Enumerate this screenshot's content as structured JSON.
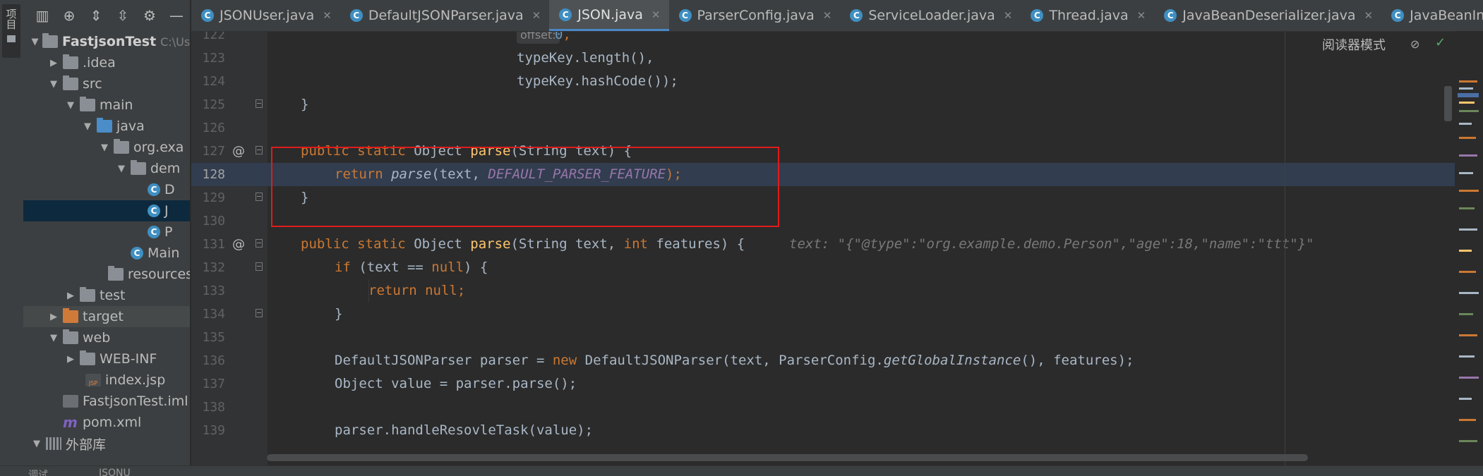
{
  "left_strip": {
    "label": "项目"
  },
  "project": {
    "root": {
      "name": "FastjsonTest",
      "path": "C:\\Use"
    },
    "items": [
      {
        "label": ".idea"
      },
      {
        "label": "src"
      },
      {
        "label": "main"
      },
      {
        "label": "java"
      },
      {
        "label": "org.exa"
      },
      {
        "label": "dem"
      },
      {
        "label": "D"
      },
      {
        "label": "J"
      },
      {
        "label": "P"
      },
      {
        "label": "Main"
      },
      {
        "label": "resources"
      },
      {
        "label": "test"
      },
      {
        "label": "target"
      },
      {
        "label": "web"
      },
      {
        "label": "WEB-INF"
      },
      {
        "label": "index.jsp"
      },
      {
        "label": "FastjsonTest.iml"
      },
      {
        "label": "pom.xml"
      },
      {
        "label": "外部库"
      }
    ],
    "jsp_badge": "JSP",
    "class_badge": "C",
    "pom_badge": "m"
  },
  "tabs": [
    {
      "label": "JSONUser.java"
    },
    {
      "label": "DefaultJSONParser.java"
    },
    {
      "label": "JSON.java"
    },
    {
      "label": "ParserConfig.java"
    },
    {
      "label": "ServiceLoader.java"
    },
    {
      "label": "Thread.java"
    },
    {
      "label": "JavaBeanDeserializer.java"
    },
    {
      "label": "JavaBeanInfo.java"
    }
  ],
  "editor": {
    "reader_mode": "阅读器模式",
    "line_numbers": [
      "122",
      "123",
      "124",
      "125",
      "126",
      "127",
      "128",
      "129",
      "130",
      "131",
      "132",
      "133",
      "134",
      "135",
      "136",
      "137",
      "138",
      "139"
    ],
    "param_hint_offset": "offset:",
    "value_hint": "text: \"{\"@type\":\"org.example.demo.Person\",\"age\":18,\"name\":\"ttt\"}\"",
    "override_marker": "@",
    "code": {
      "l122_num": "0",
      "l123": "typeKey.length(),",
      "l124": "typeKey.hashCode());",
      "brace_close": "}",
      "public": "public",
      "static": "static",
      "object": "Object",
      "parse": "parse",
      "sig127_args": "(String text) {",
      "return": "return",
      "parse_call": "parse",
      "l128_mid": "(text, ",
      "default_feature": "DEFAULT_PARSER_FEATURE",
      "l128_end": ");",
      "sig131_a": "(String text, ",
      "int": "int",
      "sig131_b": " features) {",
      "if": "if",
      "l132_a": " (text == ",
      "null": "null",
      "l132_b": ") {",
      "l133_end": ";",
      "l136_a": "DefaultJSONParser parser = ",
      "new": "new",
      "l136_b": " DefaultJSONParser(text, ParserConfig.",
      "get_global": "getGlobalInstance",
      "l136_c": "(), features);",
      "l137": "Object value = parser.parse();",
      "l139": "parser.handleResovleTask(value);"
    }
  },
  "bottom_bar": {
    "left": "调试",
    "tab": "JSONU"
  },
  "colors": {
    "keyword": "#cc7832",
    "function": "#ffc66d",
    "number": "#6897bb",
    "field": "#9876aa",
    "highlight_box": "#e01b1b"
  }
}
